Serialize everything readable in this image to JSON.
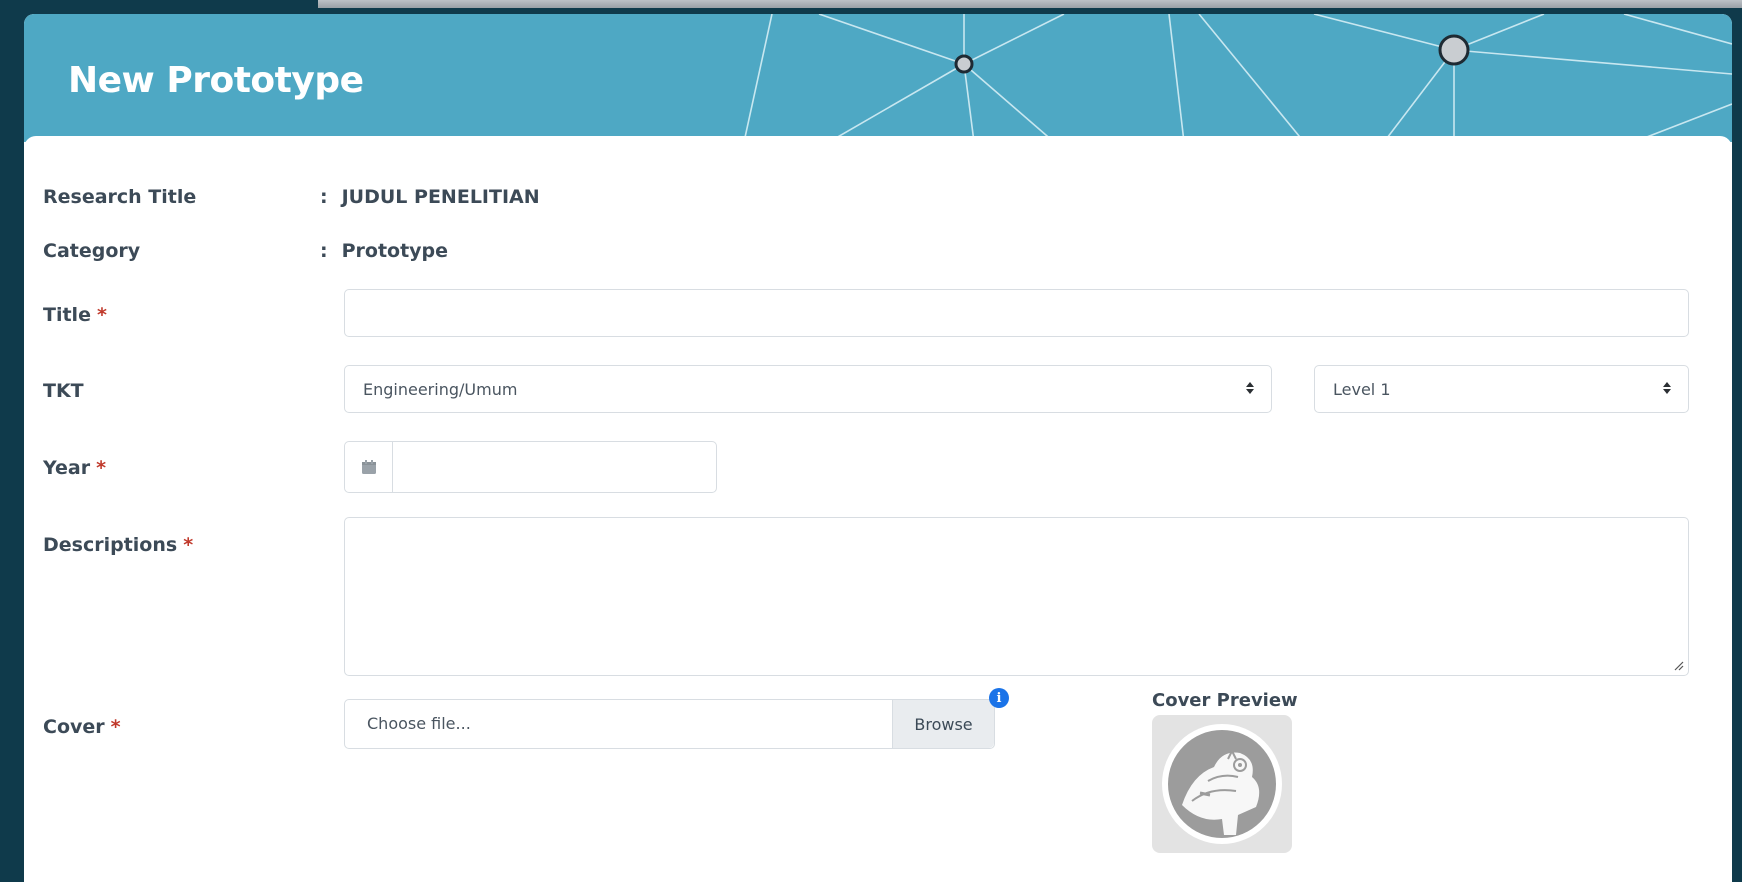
{
  "page": {
    "title": "New Prototype"
  },
  "fields": {
    "research_title": {
      "label": "Research Title",
      "colon": ":",
      "value": "JUDUL PENELITIAN"
    },
    "category": {
      "label": "Category",
      "colon": ":",
      "value": "Prototype"
    },
    "title": {
      "label": "Title",
      "required_mark": "*",
      "value": ""
    },
    "tkt": {
      "label": "TKT",
      "field_selected": "Engineering/Umum",
      "level_selected": "Level 1"
    },
    "year": {
      "label": "Year",
      "required_mark": "*",
      "value": ""
    },
    "descriptions": {
      "label": "Descriptions",
      "required_mark": "*",
      "value": ""
    },
    "cover": {
      "label": "Cover",
      "required_mark": "*",
      "placeholder": "Choose file...",
      "browse_label": "Browse",
      "info_glyph": "i"
    }
  },
  "cover_preview": {
    "label": "Cover Preview"
  },
  "icons": {
    "calendar": "calendar-icon",
    "select_caret": "sort-caret-icon",
    "info": "info-icon"
  },
  "colors": {
    "banner": "#4ea8c4",
    "background": "#0f3a4b",
    "required": "#c0392b",
    "info": "#1a73e8"
  }
}
